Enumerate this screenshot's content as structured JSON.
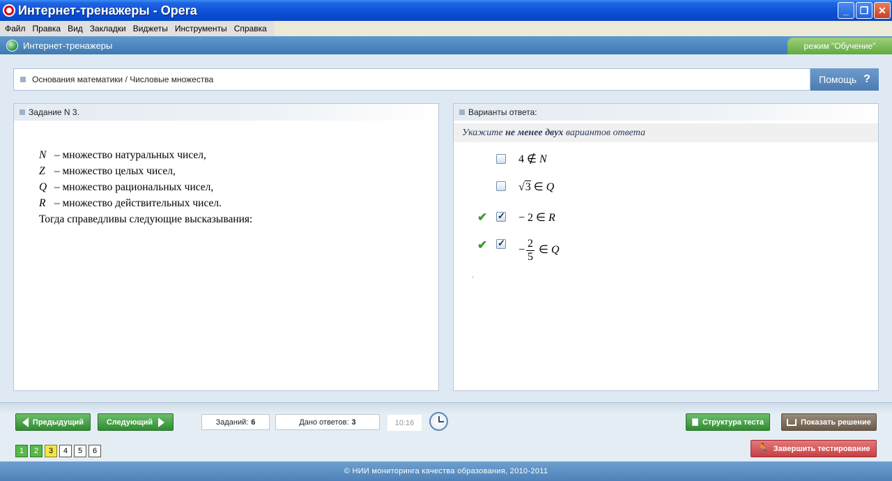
{
  "window": {
    "title": "Интернет-тренажеры - Opera",
    "minimize_glyph": "_",
    "restore_glyph": "❐",
    "close_glyph": "✕"
  },
  "menu": [
    "Файл",
    "Правка",
    "Вид",
    "Закладки",
    "Виджеты",
    "Инструменты",
    "Справка"
  ],
  "app": {
    "title": "Интернет-тренажеры",
    "mode_label": "режим \"Обучение\"",
    "breadcrumb": "Основания математики / Числовые множества",
    "help_label": "Помощь",
    "help_glyph": "?"
  },
  "task": {
    "header": "Задание N 3.",
    "lines": [
      {
        "symbol": "N",
        "text": " – множество натуральных чисел,"
      },
      {
        "symbol": "Z",
        "text": " – множество целых чисел,"
      },
      {
        "symbol": "Q",
        "text": " – множество рациональных чисел,"
      },
      {
        "symbol": "R",
        "text": " – множество действительных чисел."
      }
    ],
    "conclusion": "Тогда справедливы следующие высказывания:"
  },
  "answers": {
    "header": "Варианты ответа:",
    "instruction_pre": "Укажите",
    "instruction_bold": "не менее двух",
    "instruction_post": "вариантов ответа",
    "options": [
      {
        "left": "4",
        "rel": " ∉ ",
        "set": "N",
        "checked": false,
        "correct": false
      },
      {
        "sqrt": "3",
        "rel": " ∈ ",
        "set": "Q",
        "checked": false,
        "correct": false
      },
      {
        "left": "− 2",
        "rel": " ∈ ",
        "set": "R",
        "checked": true,
        "correct": true
      },
      {
        "minus": "−",
        "num": "2",
        "den": "5",
        "rel": " ∈ ",
        "set": "Q",
        "checked": true,
        "correct": true
      }
    ],
    "sqrt_glyph": "√",
    "check_glyph": "✔"
  },
  "bottom": {
    "prev_label": "Предыдущий",
    "next_label": "Следующий",
    "tasks_label": "Заданий:",
    "tasks_value": "6",
    "answers_label": "Дано ответов:",
    "answers_value": "3",
    "timer": "10:16",
    "structure_label": "Структура теста",
    "solution_label": "Показать решение",
    "finish_label": "Завершить тестирование",
    "runner_glyph": "🏃",
    "pages": [
      {
        "label": "1",
        "state": "done"
      },
      {
        "label": "2",
        "state": "done"
      },
      {
        "label": "3",
        "state": "current"
      },
      {
        "label": "4",
        "state": "pending"
      },
      {
        "label": "5",
        "state": "pending"
      },
      {
        "label": "6",
        "state": "pending"
      }
    ]
  },
  "footer": "© НИИ мониторинга качества образования, 2010-2011",
  "colors": {
    "accent_blue": "#4f82b8",
    "green_button": "#2f8c31",
    "current_page": "#f1e64a",
    "done_page": "#5ab84a"
  }
}
